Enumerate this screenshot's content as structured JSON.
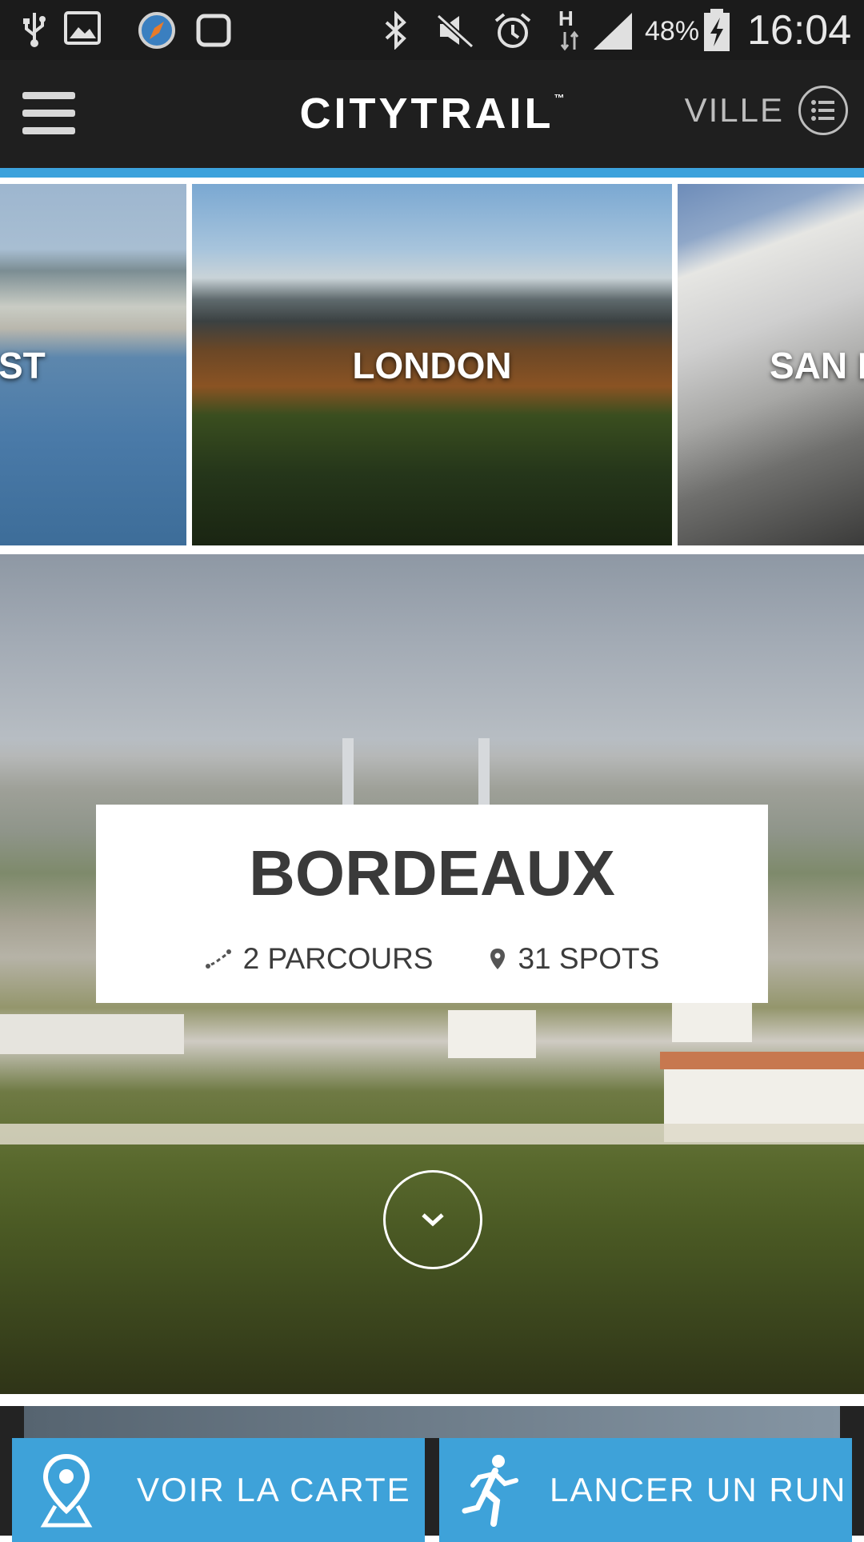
{
  "status_bar": {
    "battery_percent": "48%",
    "time": "16:04",
    "network": "H",
    "icons": [
      "usb-icon",
      "image-icon",
      "compass-icon",
      "watch-icon",
      "bluetooth-icon",
      "mute-icon",
      "alarm-icon",
      "signal-icon",
      "battery-icon"
    ]
  },
  "app_bar": {
    "brand": "CITYTRAIL",
    "trademark": "™",
    "city_button": "VILLE"
  },
  "carousel": {
    "cards": [
      {
        "label": "ST"
      },
      {
        "label": "LONDON"
      },
      {
        "label": "SAN F"
      }
    ]
  },
  "hero": {
    "city": "BORDEAUX",
    "routes": "2 PARCOURS",
    "spots": "31 SPOTS"
  },
  "actions": {
    "map_label": "VOIR LA CARTE",
    "run_label": "LANCER UN RUN"
  },
  "colors": {
    "accent": "#3ca2dc",
    "button": "#3ea2d9",
    "bar": "#1f1f1f"
  }
}
